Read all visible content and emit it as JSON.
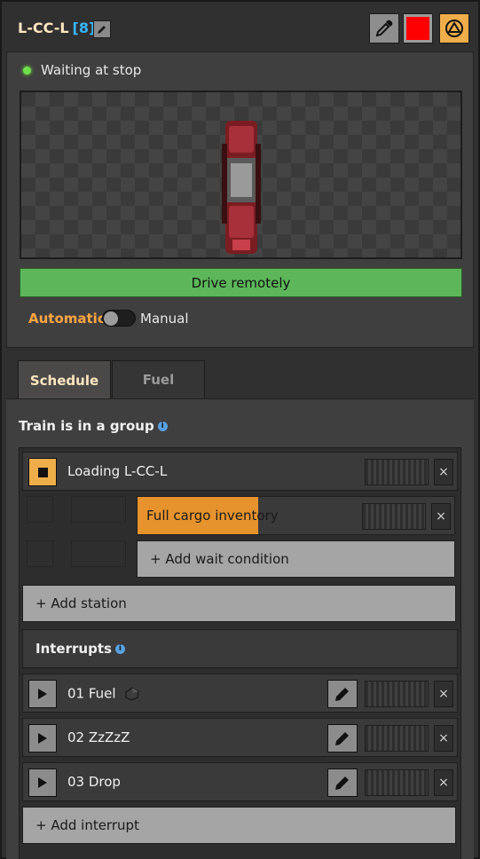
{
  "train": {
    "name": "L-CC-L",
    "id_badge": "[8]",
    "color": "#ff0000",
    "status": "Waiting at stop"
  },
  "controls": {
    "drive_remotely": "Drive remotely",
    "mode_automatic": "Automatic",
    "mode_manual": "Manual"
  },
  "tabs": [
    {
      "label": "Schedule",
      "active": true
    },
    {
      "label": "Fuel",
      "active": false
    }
  ],
  "schedule": {
    "group_text": "Train is in a group",
    "station": {
      "name": "Loading L-CC-L"
    },
    "conditions": [
      {
        "label": "Full cargo inventory",
        "progress_fraction": 0.38
      }
    ],
    "add_wait_condition": "+ Add wait condition",
    "add_station": "+ Add station",
    "interrupts_title": "Interrupts",
    "interrupts": [
      {
        "name": "01 Fuel",
        "icon": "coal-icon"
      },
      {
        "name": "02 ZzZzZ"
      },
      {
        "name": "03 Drop"
      }
    ],
    "add_interrupt": "+ Add interrupt"
  },
  "close_glyph": "×"
}
